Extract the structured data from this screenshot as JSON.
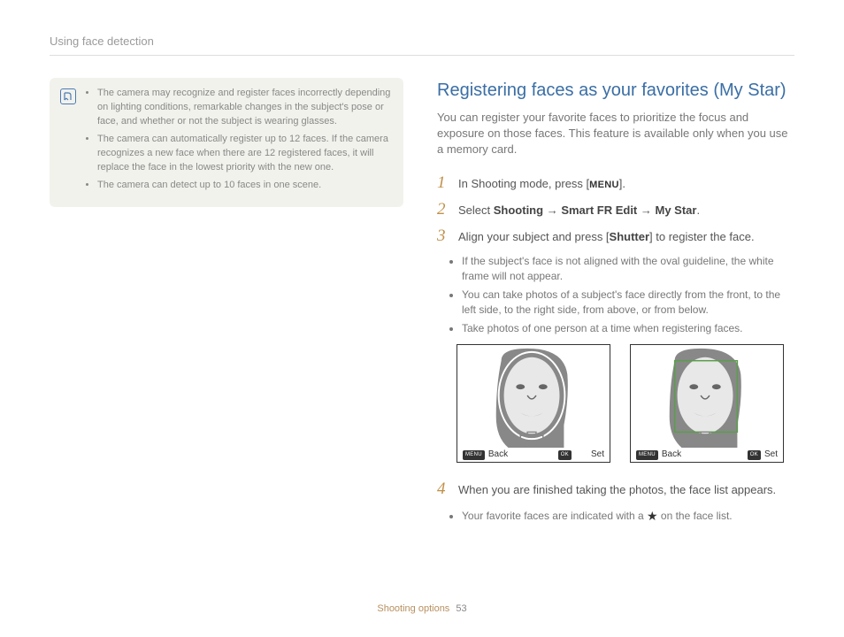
{
  "header": {
    "section": "Using face detection"
  },
  "note": {
    "items": [
      "The camera may recognize and register faces incorrectly depending on lighting conditions, remarkable changes in the subject's pose or face, and whether or not the subject is wearing glasses.",
      "The camera can automatically register up to 12 faces. If the camera recognizes a new face when there are 12 registered faces, it will replace the face in the lowest priority with the new one.",
      "The camera can detect up to 10 faces in one scene."
    ]
  },
  "right": {
    "heading": "Registering faces as your favorites (My Star)",
    "intro": "You can register your favorite faces to prioritize the focus and exposure on those faces. This feature is available only when you use a memory card.",
    "step1_pre": "In Shooting mode, press [",
    "step1_menu": "MENU",
    "step1_post": "].",
    "step2_pre": "Select ",
    "step2_path1": "Shooting",
    "step2_arrow": " → ",
    "step2_path2": "Smart FR Edit",
    "step2_path3": "My Star",
    "step2_end": ".",
    "step3_pre": "Align your subject and press [",
    "step3_btn": "Shutter",
    "step3_post": "] to register the face.",
    "step3_bullets": [
      "If the subject's face is not aligned with the oval guideline, the white frame will not appear.",
      "You can take photos of a subject's face directly from the front, to the left side, to the right side, from above, or from below.",
      "Take photos of one person at a time when registering faces."
    ],
    "screens": {
      "menu_badge": "MENU",
      "ok_badge": "OK",
      "back": "Back",
      "set": "Set"
    },
    "step4": "When you are finished taking the photos, the face list appears.",
    "step4_bullet_pre": "Your favorite faces are indicated with a ",
    "step4_bullet_post": " on the face list."
  },
  "footer": {
    "section": "Shooting options",
    "page": "53"
  }
}
